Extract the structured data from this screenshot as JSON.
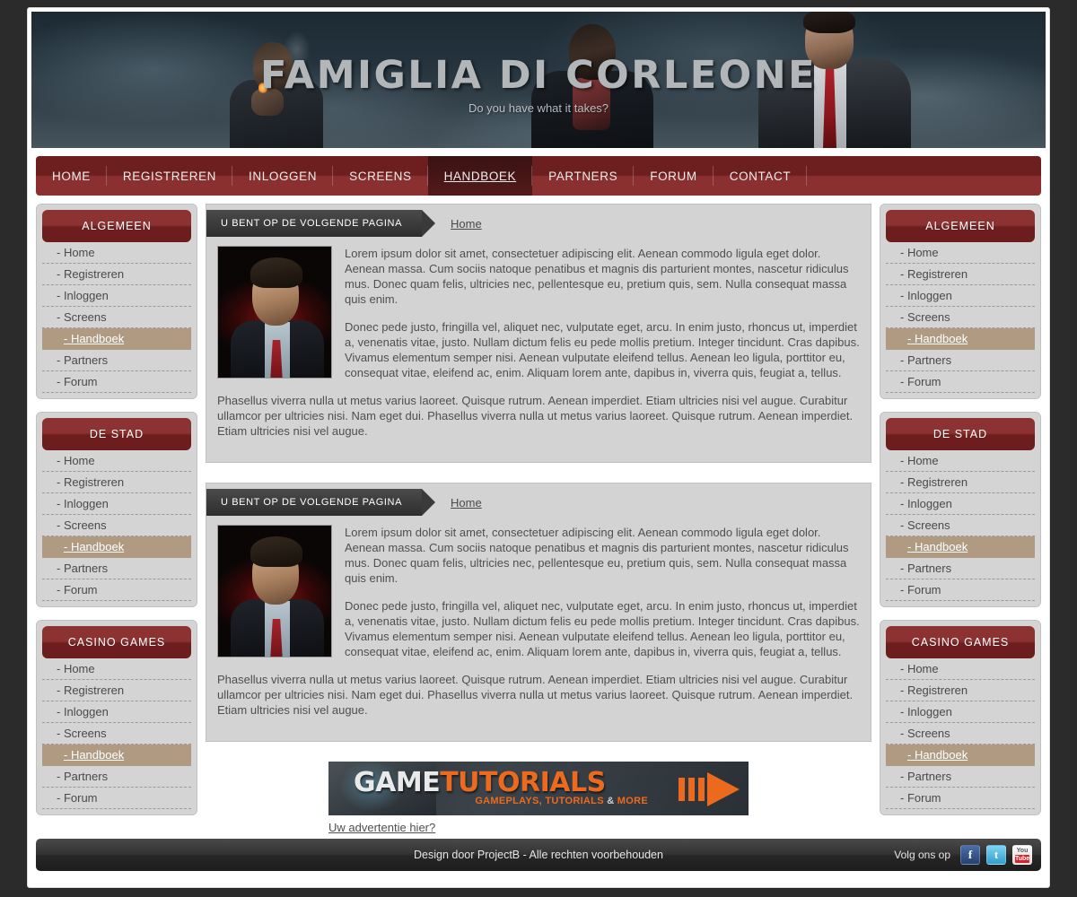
{
  "site": {
    "title": "FAMIGLIA DI CORLEONE",
    "tagline": "Do you have what it takes?"
  },
  "nav": {
    "items": [
      {
        "label": "HOME",
        "active": false
      },
      {
        "label": "REGISTREREN",
        "active": false
      },
      {
        "label": "INLOGGEN",
        "active": false
      },
      {
        "label": "SCREENS",
        "active": false
      },
      {
        "label": "HANDBOEK",
        "active": true
      },
      {
        "label": "PARTNERS",
        "active": false
      },
      {
        "label": "FORUM",
        "active": false
      },
      {
        "label": "CONTACT",
        "active": false
      }
    ]
  },
  "sidebar": {
    "blocks": [
      {
        "title": "ALGEMEEN",
        "items": [
          {
            "label": "- Home",
            "active": false
          },
          {
            "label": "- Registreren",
            "active": false
          },
          {
            "label": "- Inloggen",
            "active": false
          },
          {
            "label": "- Screens",
            "active": false
          },
          {
            "label": "- Handboek",
            "active": true
          },
          {
            "label": "- Partners",
            "active": false
          },
          {
            "label": "- Forum",
            "active": false
          }
        ]
      },
      {
        "title": "DE STAD",
        "items": [
          {
            "label": "- Home",
            "active": false
          },
          {
            "label": "- Registreren",
            "active": false
          },
          {
            "label": "- Inloggen",
            "active": false
          },
          {
            "label": "- Screens",
            "active": false
          },
          {
            "label": "- Handboek",
            "active": true
          },
          {
            "label": "- Partners",
            "active": false
          },
          {
            "label": "- Forum",
            "active": false
          }
        ]
      },
      {
        "title": "CASINO GAMES",
        "items": [
          {
            "label": "- Home",
            "active": false
          },
          {
            "label": "- Registreren",
            "active": false
          },
          {
            "label": "- Inloggen",
            "active": false
          },
          {
            "label": "- Screens",
            "active": false
          },
          {
            "label": "- Handboek",
            "active": true
          },
          {
            "label": "- Partners",
            "active": false
          },
          {
            "label": "- Forum",
            "active": false
          }
        ]
      }
    ]
  },
  "panels": [
    {
      "crumb_banner": "U BENT OP DE VOLGENDE PAGINA",
      "crumb_link": "Home",
      "paragraphs": [
        "Lorem ipsum dolor sit amet, consectetuer adipiscing elit. Aenean commodo ligula eget dolor. Aenean massa. Cum sociis natoque penatibus et magnis dis parturient montes, nascetur ridiculus mus. Donec quam felis, ultricies nec, pellentesque eu, pretium quis, sem. Nulla consequat massa quis enim.",
        "Donec pede justo, fringilla vel, aliquet nec, vulputate eget, arcu. In enim justo, rhoncus ut, imperdiet a, venenatis vitae, justo. Nullam dictum felis eu pede mollis pretium. Integer tincidunt. Cras dapibus. Vivamus elementum semper nisi. Aenean vulputate eleifend tellus. Aenean leo ligula, porttitor eu, consequat vitae, eleifend ac, enim. Aliquam lorem ante, dapibus in, viverra quis, feugiat a, tellus."
      ],
      "wide_paragraph": "Phasellus viverra nulla ut metus varius laoreet. Quisque rutrum. Aenean imperdiet. Etiam ultricies nisi vel augue. Curabitur ullamcor per ultricies nisi. Nam eget dui. Phasellus viverra nulla ut metus varius laoreet. Quisque rutrum. Aenean imperdiet. Etiam ultricies nisi vel augue."
    },
    {
      "crumb_banner": "U BENT OP DE VOLGENDE PAGINA",
      "crumb_link": "Home",
      "paragraphs": [
        "Lorem ipsum dolor sit amet, consectetuer adipiscing elit. Aenean commodo ligula eget dolor. Aenean massa. Cum sociis natoque penatibus et magnis dis parturient montes, nascetur ridiculus mus. Donec quam felis, ultricies nec, pellentesque eu, pretium quis, sem. Nulla consequat massa quis enim.",
        "Donec pede justo, fringilla vel, aliquet nec, vulputate eget, arcu. In enim justo, rhoncus ut, imperdiet a, venenatis vitae, justo. Nullam dictum felis eu pede mollis pretium. Integer tincidunt. Cras dapibus. Vivamus elementum semper nisi. Aenean vulputate eleifend tellus. Aenean leo ligula, porttitor eu, consequat vitae, eleifend ac, enim. Aliquam lorem ante, dapibus in, viverra quis, feugiat a, tellus."
      ],
      "wide_paragraph": "Phasellus viverra nulla ut metus varius laoreet. Quisque rutrum. Aenean imperdiet. Etiam ultricies nisi vel augue. Curabitur ullamcor per ultricies nisi. Nam eget dui. Phasellus viverra nulla ut metus varius laoreet. Quisque rutrum. Aenean imperdiet. Etiam ultricies nisi vel augue."
    }
  ],
  "ad": {
    "title_part1": "GAME",
    "title_part2": "TUTORIALS",
    "subtitle_part1": "GAMEPLAYS, TUTORIALS ",
    "subtitle_amp": "&",
    "subtitle_part2": " MORE",
    "link": "Uw advertentie hier?"
  },
  "footer": {
    "copyright": "Design door ProjectB - Alle rechten voorbehouden",
    "follow": "Volg ons op",
    "social": [
      {
        "name": "facebook",
        "glyph": "f"
      },
      {
        "name": "twitter",
        "glyph": "t"
      },
      {
        "name": "youtube",
        "line1": "You",
        "line2": "Tube"
      }
    ]
  },
  "colors": {
    "brand_maroon": "#6d1e1e",
    "brand_maroon_light": "#8a3030",
    "active_tan": "#b09b82",
    "panel_gray": "#d3d3d3",
    "accent_orange": "#ec6a1e"
  }
}
